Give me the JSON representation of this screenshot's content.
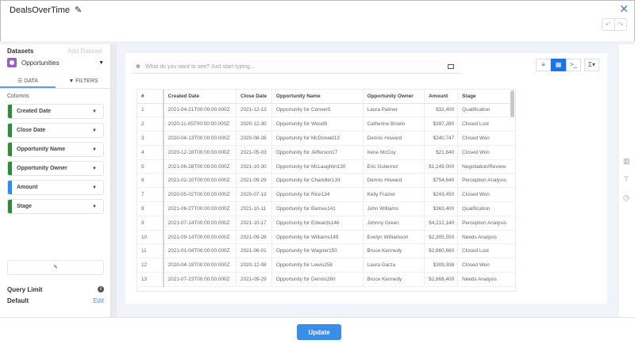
{
  "header": {
    "title": "DealsOverTime",
    "close": "✕",
    "undo": "↶",
    "redo": "↷"
  },
  "sidebar": {
    "datasets_label": "Datasets",
    "add_dataset": "Add Dataset",
    "dataset": "Opportunities",
    "tabs": [
      {
        "label": "☰ DATA"
      },
      {
        "label": "▼ FILTERS"
      }
    ],
    "columns_label": "Columns",
    "columns": [
      {
        "label": "Created Date",
        "color": "#2e8b3a"
      },
      {
        "label": "Close Date",
        "color": "#2e8b3a"
      },
      {
        "label": "Opportunity Name",
        "color": "#2e8b3a"
      },
      {
        "label": "Opportunity Owner",
        "color": "#2e8b3a"
      },
      {
        "label": "Amount",
        "color": "#2f8bf0"
      },
      {
        "label": "Stage",
        "color": "#2e8b3a"
      }
    ],
    "query_limit": "Query Limit",
    "default": "Default",
    "edit": "Edit"
  },
  "main": {
    "search_placeholder": "What do you want to see? Just start typing...",
    "table": {
      "headers": [
        "#",
        "Created Date",
        "Close Date",
        "Opportunity Name",
        "Opportunity Owner",
        "Amount",
        "Stage"
      ],
      "rows": [
        [
          "1",
          "2021-04-21T00:00:00.000Z",
          "2021-12-13",
          "Opportunity for Conner5",
          "Laura Palmer",
          "$32,400",
          "Qualification"
        ],
        [
          "2",
          "2020-11-05T00:00:00.000Z",
          "2020-12-30",
          "Opportunity for Wood9",
          "Catherine Brown",
          "$397,280",
          "Closed Lost"
        ],
        [
          "3",
          "2020-04-13T00:00:00.000Z",
          "2020-08-26",
          "Opportunity for McDonald13",
          "Dennis Howard",
          "$240,747",
          "Closed Won"
        ],
        [
          "4",
          "2020-12-18T00:00:00.000Z",
          "2021-05-03",
          "Opportunity for Jefferson17",
          "Irene McCoy",
          "$21,640",
          "Closed Won"
        ],
        [
          "5",
          "2021-06-28T00:00:00.000Z",
          "2021-10-30",
          "Opportunity for McLaughlin130",
          "Eric Gutierrez",
          "$1,249,000",
          "Negotiation/Review"
        ],
        [
          "6",
          "2021-02-10T00:00:00.000Z",
          "2021-09-29",
          "Opportunity for Chandler133",
          "Dennis Howard",
          "$754,640",
          "Perception Analysis"
        ],
        [
          "7",
          "2020-05-02T00:00:00.000Z",
          "2020-07-13",
          "Opportunity for Rice134",
          "Kelly Frazier",
          "$243,450",
          "Closed Won"
        ],
        [
          "8",
          "2021-06-27T00:00:00.000Z",
          "2021-10-11",
          "Opportunity for Barnes141",
          "John Williams",
          "$363,400",
          "Qualification"
        ],
        [
          "9",
          "2021-07-14T00:00:00.000Z",
          "2021-10-17",
          "Opportunity for Edwards146",
          "Johnny Green",
          "$4,212,140",
          "Perception Analysis"
        ],
        [
          "10",
          "2021-09-14T00:00:00.000Z",
          "2021-09-28",
          "Opportunity for Williams149",
          "Evelyn Williamson",
          "$2,305,550",
          "Needs Analysis"
        ],
        [
          "11",
          "2021-01-04T00:00:00.000Z",
          "2021-06-01",
          "Opportunity for Wagner150",
          "Bruce Kennedy",
          "$2,660,660",
          "Closed Lost"
        ],
        [
          "12",
          "2020-04-19T00:00:00.000Z",
          "2020-12-08",
          "Opportunity for Lewis258",
          "Laura Garza",
          "$309,938",
          "Closed Won"
        ],
        [
          "13",
          "2021-07-23T00:00:00.000Z",
          "2021-09-29",
          "Opportunity for Dennis260",
          "Bruce Kennedy",
          "$2,868,400",
          "Needs Analysis"
        ]
      ]
    }
  },
  "footer": {
    "update": "Update"
  },
  "colors": {
    "accent": "#3a8ee6",
    "active_view": "#1a73e8"
  }
}
